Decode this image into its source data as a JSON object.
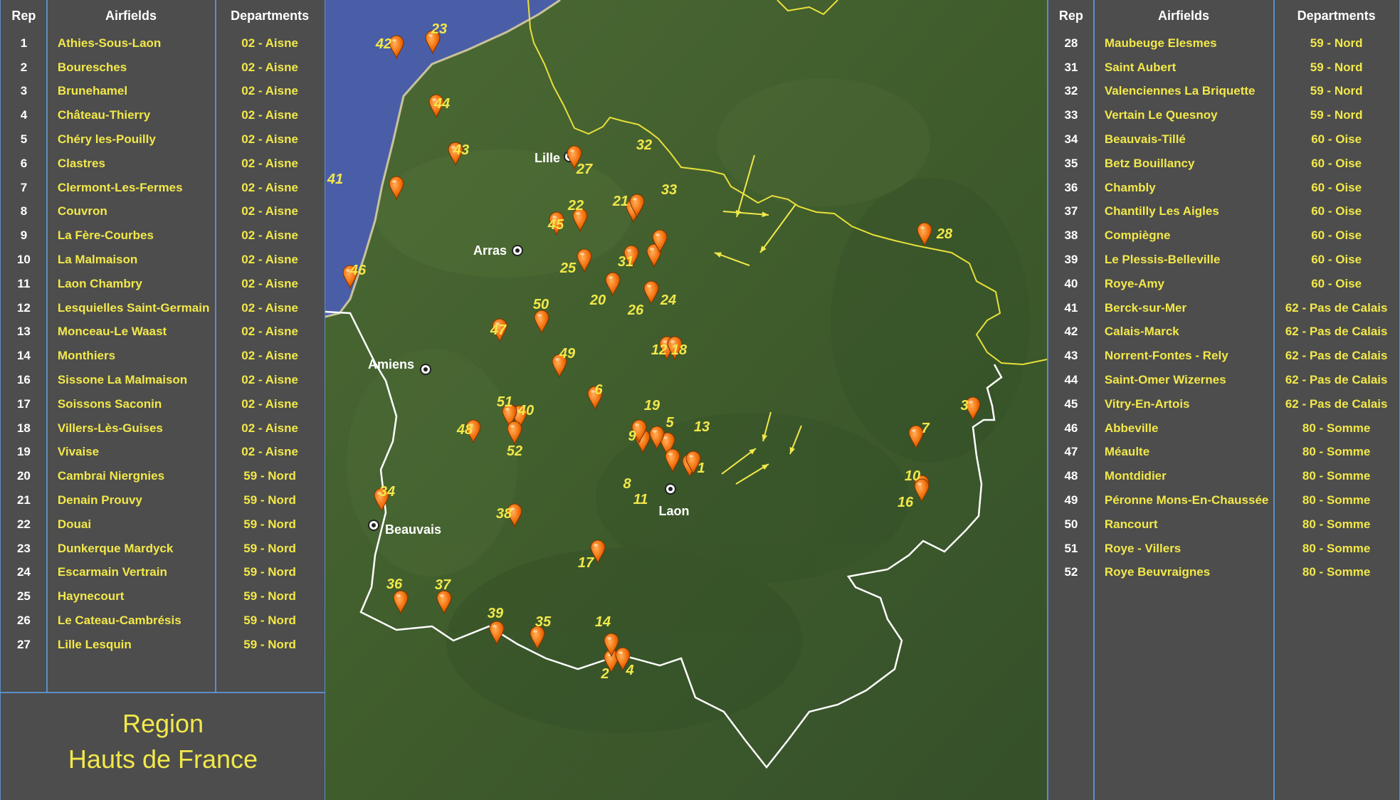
{
  "left_table": {
    "headers": {
      "rep": "Rep",
      "airfields": "Airfields",
      "departments": "Departments"
    },
    "rows": [
      {
        "rep": "1",
        "airfield": "Athies-Sous-Laon",
        "department": "02 - Aisne"
      },
      {
        "rep": "2",
        "airfield": "Bouresches",
        "department": "02 - Aisne"
      },
      {
        "rep": "3",
        "airfield": "Brunehamel",
        "department": "02 - Aisne"
      },
      {
        "rep": "4",
        "airfield": "Château-Thierry",
        "department": "02 - Aisne"
      },
      {
        "rep": "5",
        "airfield": "Chéry les-Pouilly",
        "department": "02 - Aisne"
      },
      {
        "rep": "6",
        "airfield": "Clastres",
        "department": "02 - Aisne"
      },
      {
        "rep": "7",
        "airfield": "Clermont-Les-Fermes",
        "department": "02 - Aisne"
      },
      {
        "rep": "8",
        "airfield": "Couvron",
        "department": "02 - Aisne"
      },
      {
        "rep": "9",
        "airfield": "La Fère-Courbes",
        "department": "02 - Aisne"
      },
      {
        "rep": "10",
        "airfield": "La Malmaison",
        "department": "02 - Aisne"
      },
      {
        "rep": "11",
        "airfield": "Laon Chambry",
        "department": "02 - Aisne"
      },
      {
        "rep": "12",
        "airfield": "Lesquielles Saint-Germain",
        "department": "02 - Aisne"
      },
      {
        "rep": "13",
        "airfield": "Monceau-Le Waast",
        "department": "02 - Aisne"
      },
      {
        "rep": "14",
        "airfield": "Monthiers",
        "department": "02 - Aisne"
      },
      {
        "rep": "16",
        "airfield": "Sissone La Malmaison",
        "department": "02 - Aisne"
      },
      {
        "rep": "17",
        "airfield": "Soissons Saconin",
        "department": "02 - Aisne"
      },
      {
        "rep": "18",
        "airfield": "Villers-Lès-Guises",
        "department": "02 - Aisne"
      },
      {
        "rep": "19",
        "airfield": "Vivaise",
        "department": "02 - Aisne"
      },
      {
        "rep": "20",
        "airfield": "Cambrai Niergnies",
        "department": "59 - Nord"
      },
      {
        "rep": "21",
        "airfield": "Denain Prouvy",
        "department": "59 - Nord"
      },
      {
        "rep": "22",
        "airfield": "Douai",
        "department": "59 - Nord"
      },
      {
        "rep": "23",
        "airfield": "Dunkerque Mardyck",
        "department": "59 - Nord"
      },
      {
        "rep": "24",
        "airfield": "Escarmain Vertrain",
        "department": "59 - Nord"
      },
      {
        "rep": "25",
        "airfield": "Haynecourt",
        "department": "59 - Nord"
      },
      {
        "rep": "26",
        "airfield": "Le Cateau-Cambrésis",
        "department": "59 - Nord"
      },
      {
        "rep": "27",
        "airfield": "Lille Lesquin",
        "department": "59 - Nord"
      }
    ]
  },
  "right_table": {
    "headers": {
      "rep": "Rep",
      "airfields": "Airfields",
      "departments": "Departments"
    },
    "rows": [
      {
        "rep": "28",
        "airfield": "Maubeuge Elesmes",
        "department": "59 - Nord"
      },
      {
        "rep": "31",
        "airfield": "Saint Aubert",
        "department": "59 - Nord"
      },
      {
        "rep": "32",
        "airfield": "Valenciennes La Briquette",
        "department": "59 - Nord"
      },
      {
        "rep": "33",
        "airfield": "Vertain Le Quesnoy",
        "department": "59 - Nord"
      },
      {
        "rep": "34",
        "airfield": "Beauvais-Tillé",
        "department": "60 - Oise"
      },
      {
        "rep": "35",
        "airfield": "Betz Bouillancy",
        "department": "60 - Oise"
      },
      {
        "rep": "36",
        "airfield": "Chambly",
        "department": "60 - Oise"
      },
      {
        "rep": "37",
        "airfield": "Chantilly Les Aigles",
        "department": "60 - Oise"
      },
      {
        "rep": "38",
        "airfield": "Compiègne",
        "department": "60 - Oise"
      },
      {
        "rep": "39",
        "airfield": "Le Plessis-Belleville",
        "department": "60 - Oise"
      },
      {
        "rep": "40",
        "airfield": "Roye-Amy",
        "department": "60 - Oise"
      },
      {
        "rep": "41",
        "airfield": "Berck-sur-Mer",
        "department": "62 - Pas de Calais"
      },
      {
        "rep": "42",
        "airfield": "Calais-Marck",
        "department": "62 - Pas de Calais"
      },
      {
        "rep": "43",
        "airfield": "Norrent-Fontes - Rely",
        "department": "62 - Pas de Calais"
      },
      {
        "rep": "44",
        "airfield": "Saint-Omer Wizernes",
        "department": "62 - Pas de Calais"
      },
      {
        "rep": "45",
        "airfield": "Vitry-En-Artois",
        "department": "62 - Pas de Calais"
      },
      {
        "rep": "46",
        "airfield": "Abbeville",
        "department": "80 - Somme"
      },
      {
        "rep": "47",
        "airfield": "Méaulte",
        "department": "80 - Somme"
      },
      {
        "rep": "48",
        "airfield": "Montdidier",
        "department": "80 - Somme"
      },
      {
        "rep": "49",
        "airfield": "Péronne Mons-En-Chaussée",
        "department": "80 - Somme"
      },
      {
        "rep": "50",
        "airfield": "Rancourt",
        "department": "80 - Somme"
      },
      {
        "rep": "51",
        "airfield": "Roye - Villers",
        "department": "80 - Somme"
      },
      {
        "rep": "52",
        "airfield": "Roye Beuvraignes",
        "department": "80 - Somme"
      }
    ]
  },
  "region": {
    "line1": "Region",
    "line2": "Hauts de France"
  },
  "map": {
    "cities": [
      "Lille",
      "Arras",
      "Amiens",
      "Beauvais",
      "Laon"
    ],
    "marker_labels": [
      "1",
      "2",
      "3",
      "4",
      "5",
      "6",
      "7",
      "8",
      "9",
      "10",
      "11",
      "12",
      "13",
      "14",
      "16",
      "17",
      "18",
      "19",
      "20",
      "21",
      "22",
      "23",
      "24",
      "25",
      "26",
      "27",
      "28",
      "31",
      "32",
      "33",
      "34",
      "35",
      "36",
      "37",
      "38",
      "39",
      "40",
      "41",
      "42",
      "43",
      "44",
      "45",
      "46",
      "47",
      "48",
      "49",
      "50",
      "51",
      "52"
    ],
    "colors": {
      "marker": "#f26d0a",
      "label": "#f2e84a",
      "region_border": "#ffffff",
      "country_border": "#e8e03a",
      "sea": "#4a5ea8",
      "land": "#3d5a2e"
    }
  }
}
